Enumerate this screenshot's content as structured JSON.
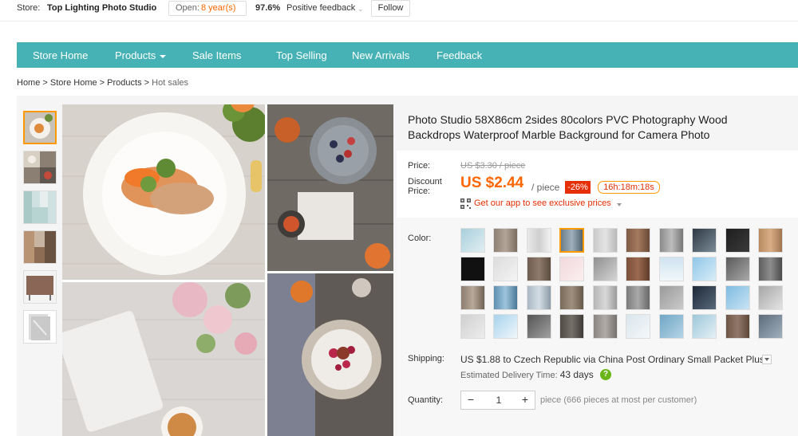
{
  "store": {
    "store_label": "Store:",
    "name": "Top Lighting Photo Studio",
    "open_label": "Open:",
    "open_value": "8 year(s)",
    "feedback_pct": "97.6%",
    "feedback_label": "Positive feedback",
    "follow_label": "Follow"
  },
  "nav": {
    "items": [
      "Store Home",
      "Products",
      "Sale Items",
      "Top Selling",
      "New Arrivals",
      "Feedback"
    ],
    "accent": "#47b2b6"
  },
  "breadcrumb": {
    "items": [
      "Home",
      "Store Home",
      "Products"
    ],
    "current": "Hot sales",
    "separator": ">"
  },
  "product": {
    "title": "Photo Studio 58X86cm 2sides 80colors PVC Photography Wood Backdrops Waterproof Marble Background for Camera Photo",
    "price_label": "Price:",
    "old_price": "US $3.30 / piece",
    "discount_label": "Discount Price:",
    "new_price": "US $2.44",
    "unit": "/ piece",
    "discount_badge": "-26%",
    "timer": "16h:18m:18s",
    "app_link": "Get our app to see exclusive prices",
    "color_label": "Color:",
    "selected_color_index": 3,
    "shipping_label": "Shipping:",
    "shipping_price": "US $1.88",
    "shipping_text": "to Czech Republic via China Post Ordinary Small Packet Plus",
    "eta_label": "Estimated Delivery Time:",
    "eta_value": "43 days",
    "quantity_label": "Quantity:",
    "quantity_value": "1",
    "quantity_minus": "−",
    "quantity_plus": "+",
    "quantity_note": "piece (666 pieces at most per customer)",
    "price_color": "#ff6600",
    "badge_color": "#e62e04"
  }
}
